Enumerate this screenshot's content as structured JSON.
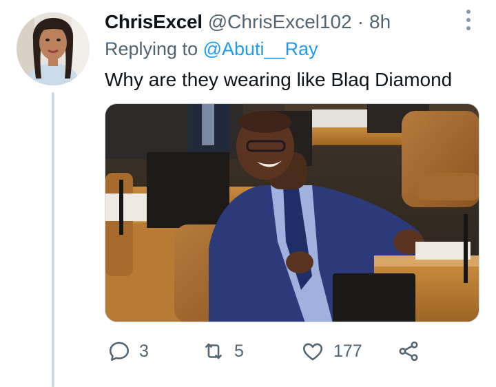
{
  "tweet": {
    "display_name": "ChrisExcel",
    "handle": "@ChrisExcel102",
    "separator": "·",
    "time": "8h",
    "replying_prefix": "Replying to",
    "replying_to": "@Abuti__Ray",
    "text": "Why are they wearing like Blaq Diamond",
    "media_icon": "photo",
    "avatar_icon": "profile-photo"
  },
  "actions": {
    "reply": {
      "icon": "reply-icon",
      "count": "3"
    },
    "retweet": {
      "icon": "retweet-icon",
      "count": "5"
    },
    "like": {
      "icon": "heart-icon",
      "count": "177"
    },
    "share": {
      "icon": "share-icon"
    }
  },
  "colors": {
    "text": "#0f1419",
    "secondary": "#536471",
    "link": "#1d9bf0",
    "thread_line": "#cfd9de"
  }
}
